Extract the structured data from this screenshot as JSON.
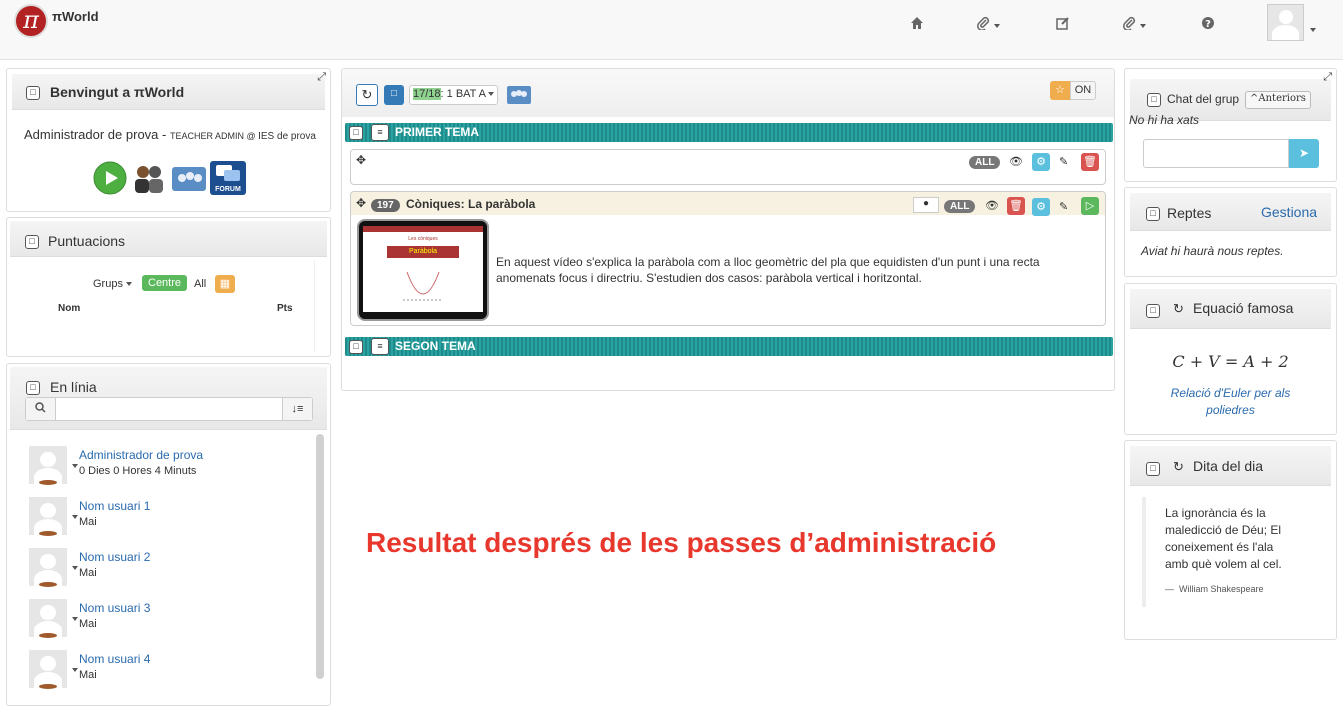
{
  "app": {
    "brand": "πWorld",
    "logo_char": "π"
  },
  "topnav": {
    "icons": [
      "home-icon",
      "paperclip-icon",
      "edit-icon",
      "paperclip-icon",
      "help-icon"
    ]
  },
  "welcome": {
    "title": "Benvingut a πWorld",
    "user_line": "Administrador de prova - ",
    "role": "TEACHER ADMIN @ ",
    "school": "IES de prova",
    "forum_label": "FORUM"
  },
  "scores": {
    "title": "Puntuacions",
    "groups_label": "Grups",
    "centre_label": "Centre",
    "all_label": "All",
    "col_name": "Nom",
    "col_points": "Pts"
  },
  "online": {
    "title": "En línia",
    "search_placeholder": "",
    "users": [
      {
        "name": "Administrador de prova",
        "status": "0 Dies 0 Hores 4 Minuts"
      },
      {
        "name": "Nom usuari 1",
        "status": "Mai"
      },
      {
        "name": "Nom usuari 2",
        "status": "Mai"
      },
      {
        "name": "Nom usuari 3",
        "status": "Mai"
      },
      {
        "name": "Nom usuari 4",
        "status": "Mai"
      }
    ]
  },
  "main": {
    "group_count": "17/18",
    "group_name": ": 1 BAT A",
    "on_label": "ON",
    "topic1": "PRIMER TEMA",
    "topic2": "SEGON TEMA",
    "all_badge": "ALL",
    "item": {
      "id": "197",
      "title": "Còniques: La paràbola",
      "description": "En aquest vídeo s'explica la paràbola com a lloc geomètric del pla que equidisten d'un punt i una recta anomenats focus i directriu. S'estudien dos casos: paràbola vertical i horitzontal.",
      "thumb_small": "Les còniques",
      "thumb_label": "Paràbola"
    },
    "overlay_text": "Resultat després de les passes d’administració"
  },
  "chat": {
    "title": "Chat del grup",
    "older_btn": "Anteriors",
    "empty": "No hi ha xats"
  },
  "challenges": {
    "title": "Reptes",
    "manage": "Gestiona",
    "message": "Aviat hi haurà nous reptes."
  },
  "equation": {
    "title": "Equació famosa",
    "formula": "C + V = A + 2",
    "caption": "Relació d'Euler per als poliedres"
  },
  "quote": {
    "title": "Dita del dia",
    "text": "La ignorància és la maledicció de Déu; El coneixement és l'ala amb què volem al cel.",
    "author": "William Shakespeare"
  },
  "colors": {
    "teal": "#1f8a8a",
    "green": "#5cb85c",
    "orange": "#f0ad4e",
    "red": "#d9534f",
    "blue": "#5bc0de",
    "link": "#2a6aad",
    "overlay": "#e8372c"
  }
}
